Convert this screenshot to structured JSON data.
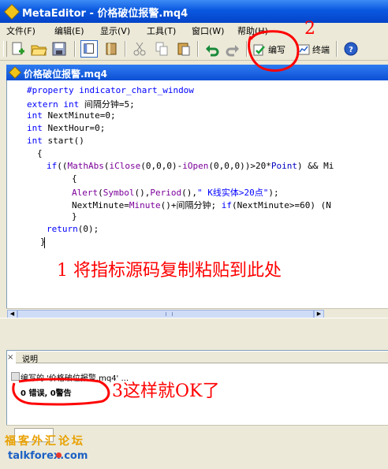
{
  "window": {
    "title": "MetaEditor - 价格破位报警.mq4"
  },
  "menu": {
    "items": [
      {
        "label": "文件(F)"
      },
      {
        "label": "编辑(E)"
      },
      {
        "label": "显示(V)"
      },
      {
        "label": "工具(T)"
      },
      {
        "label": "窗口(W)"
      },
      {
        "label": "帮助(H)"
      }
    ]
  },
  "toolbar": {
    "compile_label": "编写",
    "terminal_label": "终端"
  },
  "editor": {
    "tab_title": "价格破位报警.mq4",
    "code": {
      "l1_directive": "#property",
      "l1_value": "indicator_chart_window",
      "l2_kw1": "extern",
      "l2_kw2": "int",
      "l2_rest": "间隔分钟=5;",
      "l3_kw": "int",
      "l3_rest": "NextMinute=0;",
      "l4_kw": "int",
      "l4_rest": "NextHour=0;",
      "l5_kw": "int",
      "l5_rest": "start()",
      "l6": "{",
      "l7_if": "if",
      "l7_rest_a": "((",
      "l7_fn1": "MathAbs",
      "l7_rest_b": "(",
      "l7_fn2": "iClose",
      "l7_args1": "(0,0,0)-",
      "l7_fn3": "iOpen",
      "l7_args2": "(0,0,0))>20*",
      "l7_mac": "Point",
      "l7_tail": ") && Mi",
      "l8": "{",
      "l9_fn": "Alert",
      "l9_rest_a": "(",
      "l9_fn2": "Symbol",
      "l9_rest_b": "(),",
      "l9_fn3": "Period",
      "l9_rest_c": "(),",
      "l9_str": "\" K线实体>20点\"",
      "l9_tail": ");",
      "l10_a": "NextMinute=",
      "l10_fn": "Minute",
      "l10_b": "()+间隔分钟;",
      "l10_if": "if",
      "l10_c": "(NextMinute>=60) (N",
      "l11": "}",
      "l12_kw": "return",
      "l12_rest": "(0);",
      "l13": "}"
    }
  },
  "annotations": {
    "step1": "1 将指标源码复制粘贴到此处",
    "step2": "2",
    "step3": "3这样就OK了"
  },
  "output": {
    "close_glyph": "×",
    "header": "说明",
    "line1": "编写的 '价格破位报警.mq4' ...",
    "line2": "0 错误, 0警告"
  },
  "watermark": {
    "line1": "福客外汇论坛",
    "line2": "talkforex.com"
  }
}
